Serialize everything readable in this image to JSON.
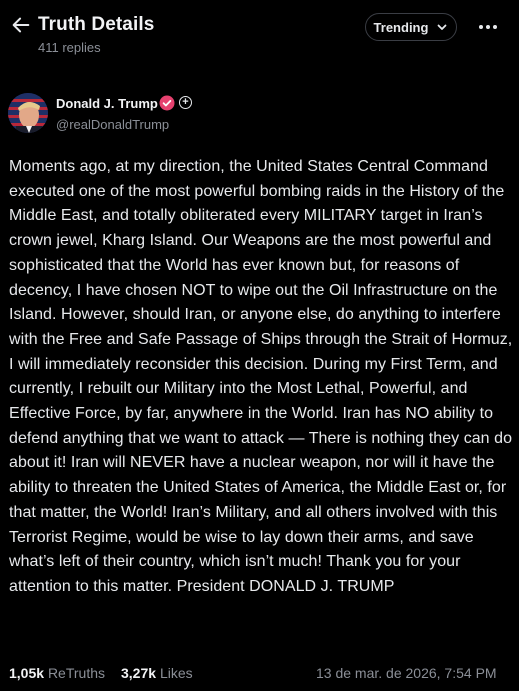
{
  "header": {
    "title": "Truth Details",
    "replies": "411 replies",
    "trending_label": "Trending",
    "back_icon": "arrow-left-icon",
    "more_icon": "more-horizontal-icon"
  },
  "author": {
    "name": "Donald J. Trump",
    "handle": "@realDonaldTrump",
    "verified_color": "#e6416f",
    "plus_label": "+"
  },
  "post": {
    "text": "Moments ago, at my direction, the United States Central Command executed one of the most powerful bombing raids in the History of the Middle East, and totally obliterated every MILITARY target in Iran’s crown jewel, Kharg Island. Our Weapons are the most powerful and sophisticated that the World has ever known but, for reasons of decency, I have chosen NOT to wipe out the Oil Infrastructure on the Island. However, should Iran, or anyone else, do anything to interfere with the Free and Safe Passage of Ships through the Strait of Hormuz, I will immediately reconsider this decision. During my First Term, and currently, I rebuilt our Military into the Most Lethal, Powerful, and Effective Force, by far, anywhere in the World. Iran has NO ability to defend anything that we want to attack — There is nothing they can do about it! Iran will NEVER have a nuclear weapon, nor will it have the ability to threaten the United States of America, the Middle East or, for that matter, the World! Iran’s Military, and all others involved with this Terrorist Regime, would be wise to lay down their arms, and save what’s left of their country, which isn’t much! Thank you for your attention to this matter. President DONALD J. TRUMP"
  },
  "stats": {
    "retruths_count": "1,05k",
    "retruths_label": "ReTruths",
    "likes_count": "3,27k",
    "likes_label": "Likes",
    "timestamp": "13 de mar. de 2026, 7:54 PM"
  }
}
